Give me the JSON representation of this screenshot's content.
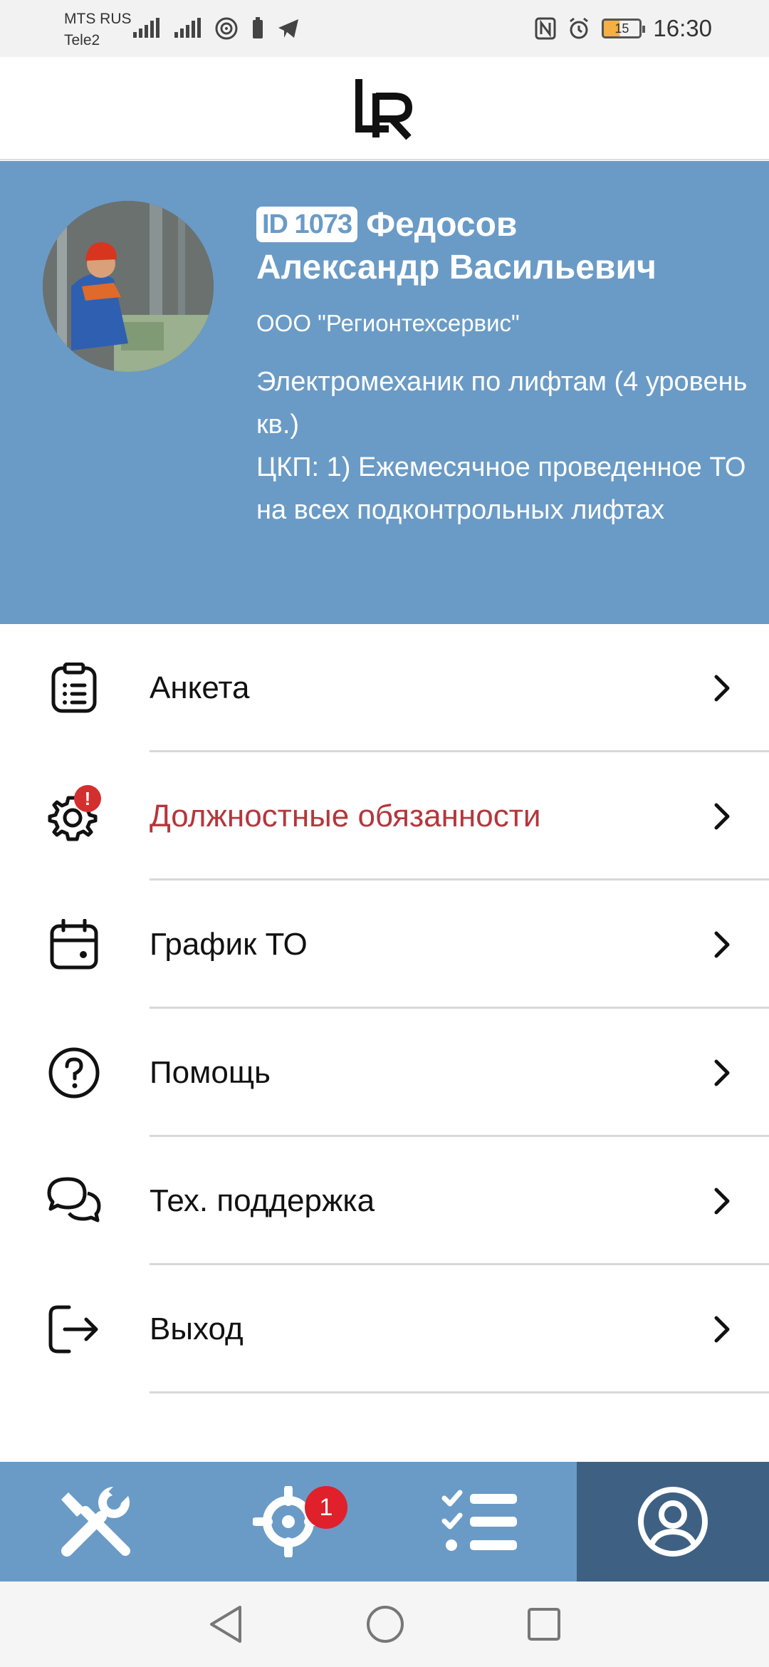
{
  "status_bar": {
    "carrier1": "MTS RUS",
    "carrier2": "Tele2",
    "battery": "15",
    "time": "16:30"
  },
  "header": {
    "logo": "LR"
  },
  "profile": {
    "id_badge": "ID 1073",
    "surname": "Федосов",
    "given_names": "Александр Васильевич",
    "company": "ООО \"Регионтехсервис\"",
    "position": "Электромеханик по лифтам (4 уровень кв.)",
    "kpi": "ЦКП: 1) Ежемесячное проведенное ТО на всех подконтрольных лифтах"
  },
  "menu": {
    "items": [
      {
        "label": "Анкета",
        "icon": "clipboard-list-icon"
      },
      {
        "label": "Должностные обязанности",
        "icon": "gear-icon",
        "alert": "!"
      },
      {
        "label": "График ТО",
        "icon": "calendar-icon"
      },
      {
        "label": "Помощь",
        "icon": "help-circle-icon"
      },
      {
        "label": "Тех. поддержка",
        "icon": "chat-bubbles-icon"
      },
      {
        "label": "Выход",
        "icon": "logout-icon"
      }
    ]
  },
  "bottom_nav": {
    "tabs": [
      {
        "icon": "tools-icon"
      },
      {
        "icon": "target-icon",
        "badge": "1"
      },
      {
        "icon": "checklist-icon"
      },
      {
        "icon": "profile-icon",
        "active": true
      }
    ]
  },
  "colors": {
    "profile_bg": "#6a9bc6",
    "nav_active": "#3e6183",
    "alert": "#b5363b",
    "badge": "#e0202a"
  }
}
